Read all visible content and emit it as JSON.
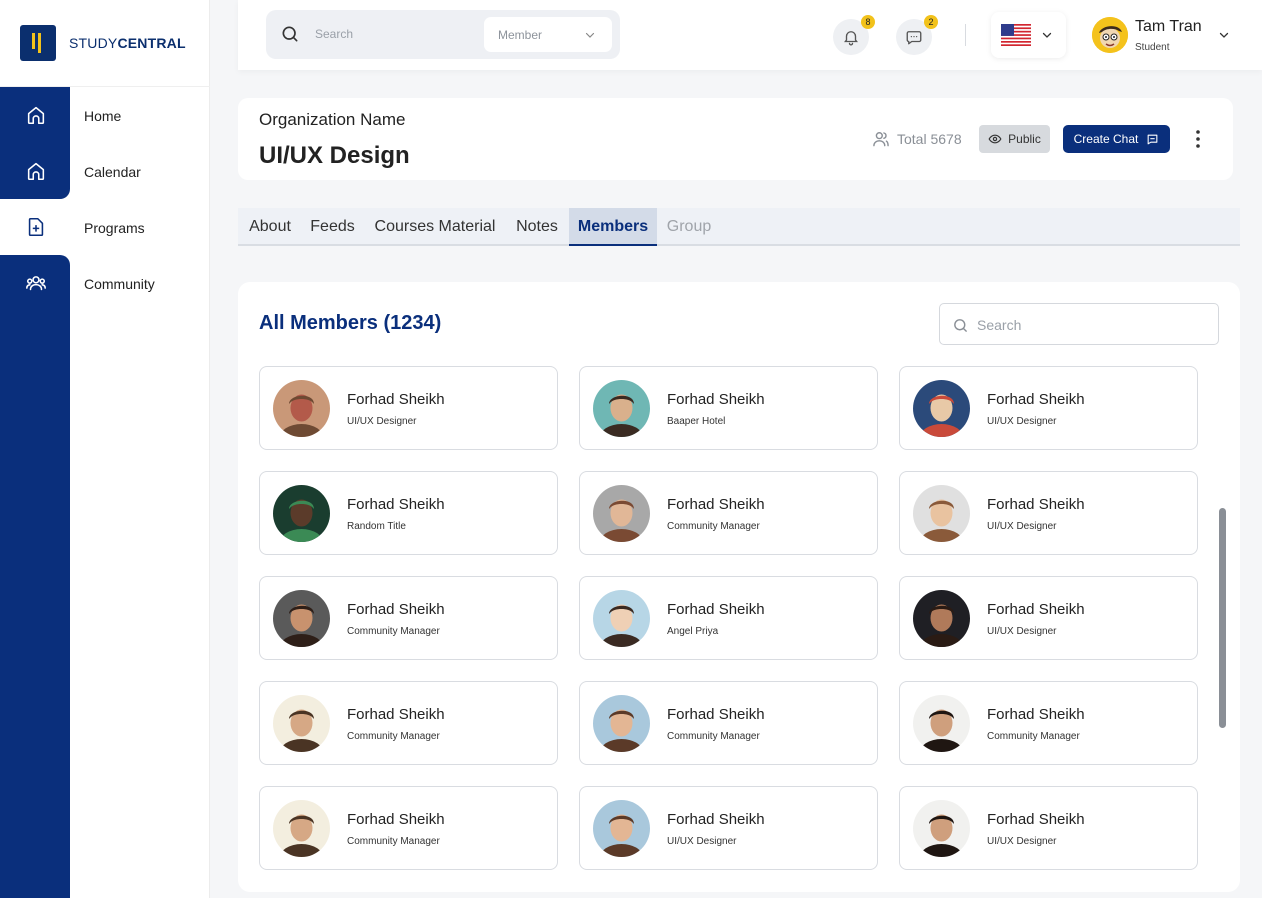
{
  "brand": {
    "prefix": "STUDY",
    "suffix": "CENTRAL"
  },
  "nav": [
    {
      "label": "Home",
      "icon": "home-icon"
    },
    {
      "label": "Calendar",
      "icon": "home-icon"
    },
    {
      "label": "Programs",
      "icon": "file-plus-icon"
    },
    {
      "label": "Community",
      "icon": "users-icon"
    }
  ],
  "topbar": {
    "search_placeholder": "Search",
    "filter_value": "Member",
    "notifications_count": "8",
    "messages_count": "2",
    "language": "United States",
    "user_name": "Tam Tran",
    "user_role": "Student"
  },
  "org": {
    "label": "Organization Name",
    "name": "UI/UX Design",
    "total": "Total 5678",
    "visibility": "Public",
    "create_chat": "Create Chat"
  },
  "tabs": [
    {
      "label": "About"
    },
    {
      "label": "Feeds"
    },
    {
      "label": "Courses Material"
    },
    {
      "label": "Notes"
    },
    {
      "label": "Members"
    },
    {
      "label": "Group"
    }
  ],
  "active_tab": "Members",
  "members_panel": {
    "title": "All Members (1234)",
    "search_placeholder": "Search",
    "members": [
      {
        "name": "Forhad Sheikh",
        "role": "UI/UX Designer"
      },
      {
        "name": "Forhad Sheikh",
        "role": "Baaper Hotel"
      },
      {
        "name": "Forhad Sheikh",
        "role": "UI/UX Designer"
      },
      {
        "name": "Forhad Sheikh",
        "role": "Random Title"
      },
      {
        "name": "Forhad Sheikh",
        "role": "Community Manager"
      },
      {
        "name": "Forhad Sheikh",
        "role": "UI/UX Designer"
      },
      {
        "name": "Forhad Sheikh",
        "role": "Community Manager"
      },
      {
        "name": "Forhad Sheikh",
        "role": "Angel Priya"
      },
      {
        "name": "Forhad Sheikh",
        "role": "UI/UX Designer"
      },
      {
        "name": "Forhad Sheikh",
        "role": "Community Manager"
      },
      {
        "name": "Forhad Sheikh",
        "role": "Community Manager"
      },
      {
        "name": "Forhad Sheikh",
        "role": "Community Manager"
      },
      {
        "name": "Forhad Sheikh",
        "role": "Community Manager"
      },
      {
        "name": "Forhad Sheikh",
        "role": "UI/UX Designer"
      },
      {
        "name": "Forhad Sheikh",
        "role": "UI/UX Designer"
      }
    ]
  },
  "colors": {
    "primary": "#0a2f7c",
    "accent": "#f2c21b",
    "page_bg": "#f5f6f8"
  }
}
